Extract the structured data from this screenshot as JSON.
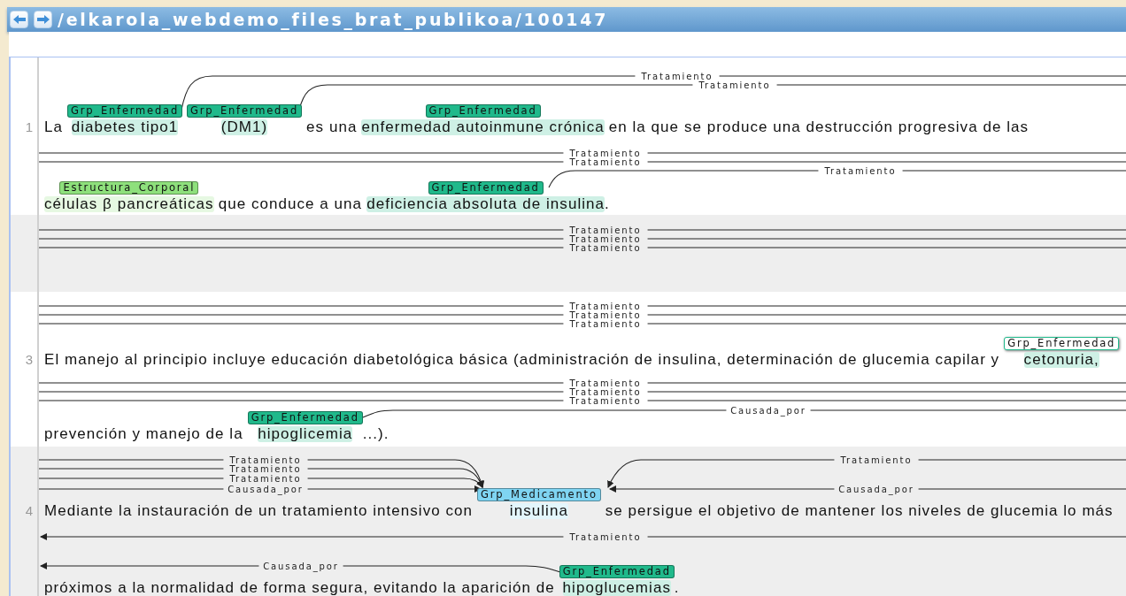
{
  "header": {
    "title": "/elkarola_webdemo_files_brat_publikoa/100147"
  },
  "sentences": [
    {
      "number": "1",
      "shaded": false,
      "lines": [
        {
          "arcs": [
            {
              "label": "Tratamiento",
              "kind": "plain"
            },
            {
              "label": "Tratamiento",
              "kind": "plain"
            }
          ],
          "tokens": [
            {
              "text": "La"
            },
            {
              "text": "diabetes tipo1",
              "label": "Grp_Enfermedad",
              "color": "#20b98b",
              "selected": false
            },
            {
              "text": "(DM1)",
              "label": "Grp_Enfermedad",
              "color": "#20b98b",
              "selected": false
            },
            {
              "text": "es una"
            },
            {
              "text": "enfermedad autoinmune crónica",
              "label": "Grp_Enfermedad",
              "color": "#20b98b",
              "selected": false
            },
            {
              "text": "en la que se produce una destrucción progresiva de las"
            }
          ]
        },
        {
          "arcs": [
            {
              "label": "Tratamiento",
              "kind": "plain"
            },
            {
              "label": "Tratamiento",
              "kind": "plain"
            },
            {
              "label": "Tratamiento",
              "kind": "plain"
            }
          ],
          "tokens": [
            {
              "text": "células β pancreáticas",
              "label": "Estructura_Corporal",
              "color": "#8ee07c",
              "selected": false
            },
            {
              "text": "que conduce a una"
            },
            {
              "text": "deficiencia absoluta de insulina",
              "label": "Grp_Enfermedad",
              "color": "#20b98b",
              "selected": false
            },
            {
              "text": ".",
              "joined": true
            }
          ]
        }
      ]
    },
    {
      "shaded": true,
      "lines": [
        {
          "arcs": [
            {
              "label": "Tratamiento",
              "kind": "plain"
            },
            {
              "label": "Tratamiento",
              "kind": "plain"
            },
            {
              "label": "Tratamiento",
              "kind": "plain"
            }
          ]
        }
      ]
    },
    {
      "number": "3",
      "shaded": false,
      "lines": [
        {
          "arcs": [
            {
              "label": "Tratamiento",
              "kind": "plain"
            },
            {
              "label": "Tratamiento",
              "kind": "plain"
            },
            {
              "label": "Tratamiento",
              "kind": "plain"
            }
          ],
          "tokens": [
            {
              "text": "El manejo al principio incluye educación diabetológica básica (administración de insulina, determinación de glucemia capilar y"
            },
            {
              "text": "cetonuria,",
              "label": "Grp_Enfermedad",
              "color": "#20b98b",
              "selected": true
            }
          ]
        },
        {
          "arcs": [
            {
              "label": "Tratamiento",
              "kind": "plain"
            },
            {
              "label": "Tratamiento",
              "kind": "plain"
            },
            {
              "label": "Tratamiento",
              "kind": "plain"
            },
            {
              "label": "Causada_por",
              "kind": "plain"
            }
          ],
          "tokens": [
            {
              "text": "prevención y manejo de la"
            },
            {
              "text": "hipoglicemia",
              "label": "Grp_Enfermedad",
              "color": "#20b98b",
              "selected": false
            },
            {
              "text": "...).",
              "joined": true
            }
          ]
        }
      ]
    },
    {
      "number": "4",
      "shaded": true,
      "lines": [
        {
          "arcs": [
            {
              "label": "Tratamiento",
              "kind": "arrow"
            },
            {
              "label": "Tratamiento",
              "kind": "arrow"
            },
            {
              "label": "Tratamiento",
              "kind": "arrow"
            },
            {
              "label": "Tratamiento",
              "kind": "arrow"
            },
            {
              "label": "Causada_por",
              "kind": "arrow"
            },
            {
              "label": "Causada_por",
              "kind": "arrow"
            }
          ],
          "tokens": [
            {
              "text": "Mediante la instauración de un tratamiento intensivo con"
            },
            {
              "text": "insulina",
              "label": "Grp_Medicamento",
              "color": "#7fd4f2",
              "selected": false
            },
            {
              "text": "se persigue el objetivo de mantener los niveles de glucemia lo más"
            }
          ]
        },
        {
          "arcs": [
            {
              "label": "Tratamiento",
              "kind": "arrow"
            },
            {
              "label": "Causada_por",
              "kind": "arrow"
            }
          ],
          "tokens": [
            {
              "text": "próximos a la normalidad de forma segura, evitando la aparición de"
            },
            {
              "text": "hipoglucemias",
              "label": "Grp_Enfermedad",
              "color": "#20b98b",
              "selected": false
            },
            {
              "text": ".",
              "joined": true
            }
          ]
        }
      ]
    }
  ]
}
